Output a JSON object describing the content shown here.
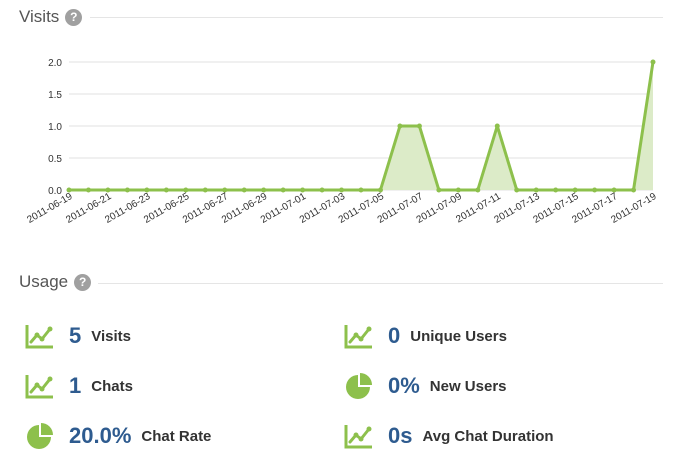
{
  "visits_section": {
    "title": "Visits",
    "help_icon": "?"
  },
  "usage_section": {
    "title": "Usage",
    "help_icon": "?"
  },
  "colors": {
    "line": "#8dc04c",
    "fill": "#dcebc8",
    "value": "#2e5b8f",
    "icon": "#8dc04c"
  },
  "chart_data": {
    "type": "area",
    "x": [
      "2011-06-19",
      "2011-06-20",
      "2011-06-21",
      "2011-06-22",
      "2011-06-23",
      "2011-06-24",
      "2011-06-25",
      "2011-06-26",
      "2011-06-27",
      "2011-06-28",
      "2011-06-29",
      "2011-06-30",
      "2011-07-01",
      "2011-07-02",
      "2011-07-03",
      "2011-07-04",
      "2011-07-05",
      "2011-07-06",
      "2011-07-07",
      "2011-07-08",
      "2011-07-09",
      "2011-07-10",
      "2011-07-11",
      "2011-07-12",
      "2011-07-13",
      "2011-07-14",
      "2011-07-15",
      "2011-07-16",
      "2011-07-17",
      "2011-07-18",
      "2011-07-19"
    ],
    "x_tick_labels": [
      "2011-06-19",
      "2011-06-21",
      "2011-06-23",
      "2011-06-25",
      "2011-06-27",
      "2011-06-29",
      "2011-07-01",
      "2011-07-03",
      "2011-07-05",
      "2011-07-07",
      "2011-07-09",
      "2011-07-11",
      "2011-07-13",
      "2011-07-15",
      "2011-07-17",
      "2011-07-19"
    ],
    "values": [
      0,
      0,
      0,
      0,
      0,
      0,
      0,
      0,
      0,
      0,
      0,
      0,
      0,
      0,
      0,
      0,
      0,
      1,
      1,
      0,
      0,
      0,
      1,
      0,
      0,
      0,
      0,
      0,
      0,
      0,
      2
    ],
    "y_ticks": [
      "0.0",
      "0.5",
      "1.0",
      "1.5",
      "2.0"
    ],
    "ylim": [
      0,
      2
    ],
    "grid": true
  },
  "stats": [
    {
      "icon": "line-chart-icon",
      "value": "5",
      "label": "Visits"
    },
    {
      "icon": "line-chart-icon",
      "value": "0",
      "label": "Unique Users"
    },
    {
      "icon": "line-chart-icon",
      "value": "1",
      "label": "Chats"
    },
    {
      "icon": "pie-chart-icon",
      "value": "0%",
      "label": "New Users"
    },
    {
      "icon": "pie-chart-icon",
      "value": "20.0%",
      "label": "Chat Rate"
    },
    {
      "icon": "line-chart-icon",
      "value": "0s",
      "label": "Avg Chat Duration"
    }
  ]
}
